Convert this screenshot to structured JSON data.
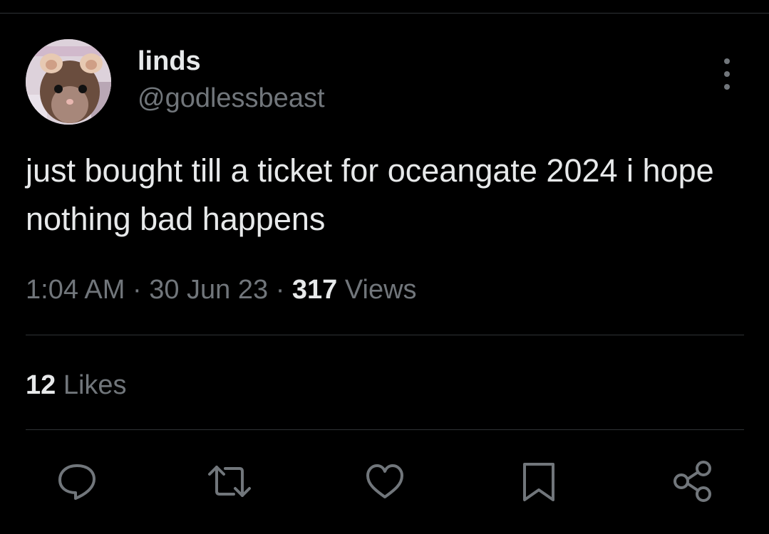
{
  "tweet": {
    "display_name": "linds",
    "handle": "@godlessbeast",
    "text": "just bought till a ticket for oceangate 2024 i hope nothing bad happens",
    "time": "1:04 AM",
    "separator": "·",
    "date": "30 Jun 23",
    "views_count": "317",
    "views_label": "Views",
    "likes_count": "12",
    "likes_label": "Likes"
  },
  "actions": [
    "reply-icon",
    "retweet-icon",
    "like-icon",
    "bookmark-icon",
    "share-icon"
  ],
  "colors": {
    "background": "#000000",
    "primary_text": "#e7e9ea",
    "secondary_text": "#71767b",
    "divider": "#2f3336"
  }
}
